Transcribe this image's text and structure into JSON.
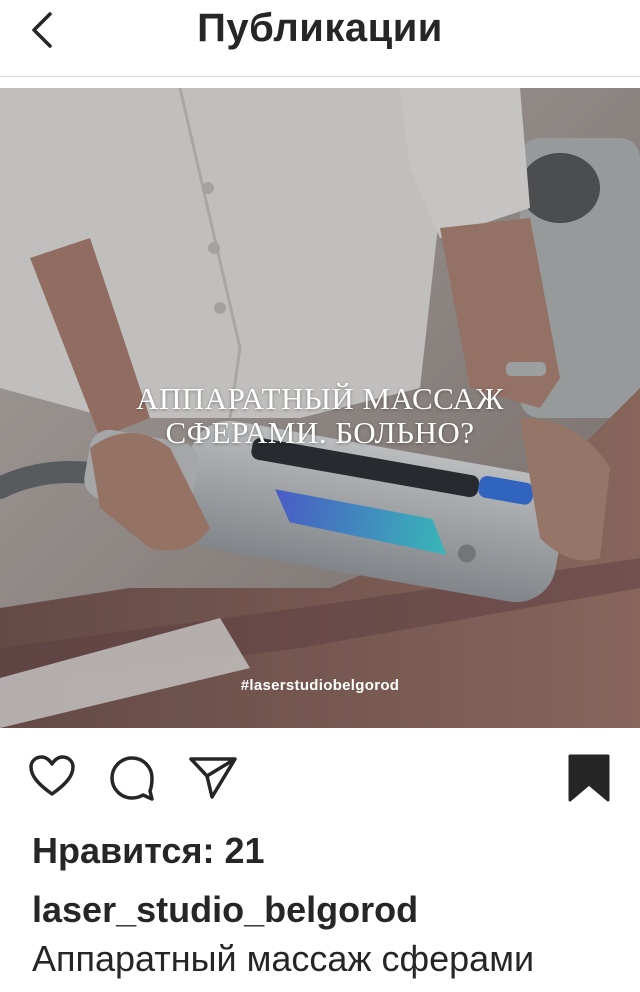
{
  "header": {
    "title": "Публикации",
    "back_icon": "chevron-left-icon"
  },
  "post": {
    "overlay_line1": "АППАРАТНЫЙ МАССАЖ",
    "overlay_line2": "СФЕРАМИ. БОЛЬНО?",
    "hashtag": "#laserstudiobelgorod"
  },
  "actions": {
    "like_icon": "heart-icon",
    "comment_icon": "comment-icon",
    "share_icon": "paper-plane-icon",
    "save_icon": "bookmark-icon",
    "saved": true
  },
  "likes": "Нравится: 21",
  "username": "laser_studio_belgorod",
  "caption": "Аппаратный массаж сферами",
  "colors": {
    "text": "#262626",
    "divider": "#dbdbdb",
    "device_light": "#3fb8e8"
  }
}
